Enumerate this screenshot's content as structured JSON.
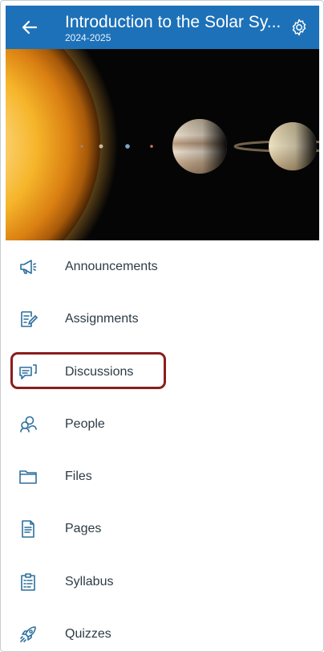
{
  "header": {
    "title": "Introduction to the Solar Sy...",
    "subtitle": "2024-2025",
    "back_icon": "arrow-left-icon",
    "settings_icon": "gear-icon",
    "background_color": "#1d71b8"
  },
  "hero": {
    "image_description_icon": "solar-system-banner"
  },
  "menu": {
    "items": [
      {
        "label": "Announcements",
        "icon": "megaphone-icon"
      },
      {
        "label": "Assignments",
        "icon": "assignment-icon"
      },
      {
        "label": "Discussions",
        "icon": "discussion-icon",
        "highlighted": true
      },
      {
        "label": "People",
        "icon": "people-icon"
      },
      {
        "label": "Files",
        "icon": "folder-icon"
      },
      {
        "label": "Pages",
        "icon": "page-icon"
      },
      {
        "label": "Syllabus",
        "icon": "syllabus-icon"
      },
      {
        "label": "Quizzes",
        "icon": "rocket-icon"
      }
    ],
    "icon_color": "#2d6f9e",
    "highlight_color": "#8b1d1d"
  }
}
